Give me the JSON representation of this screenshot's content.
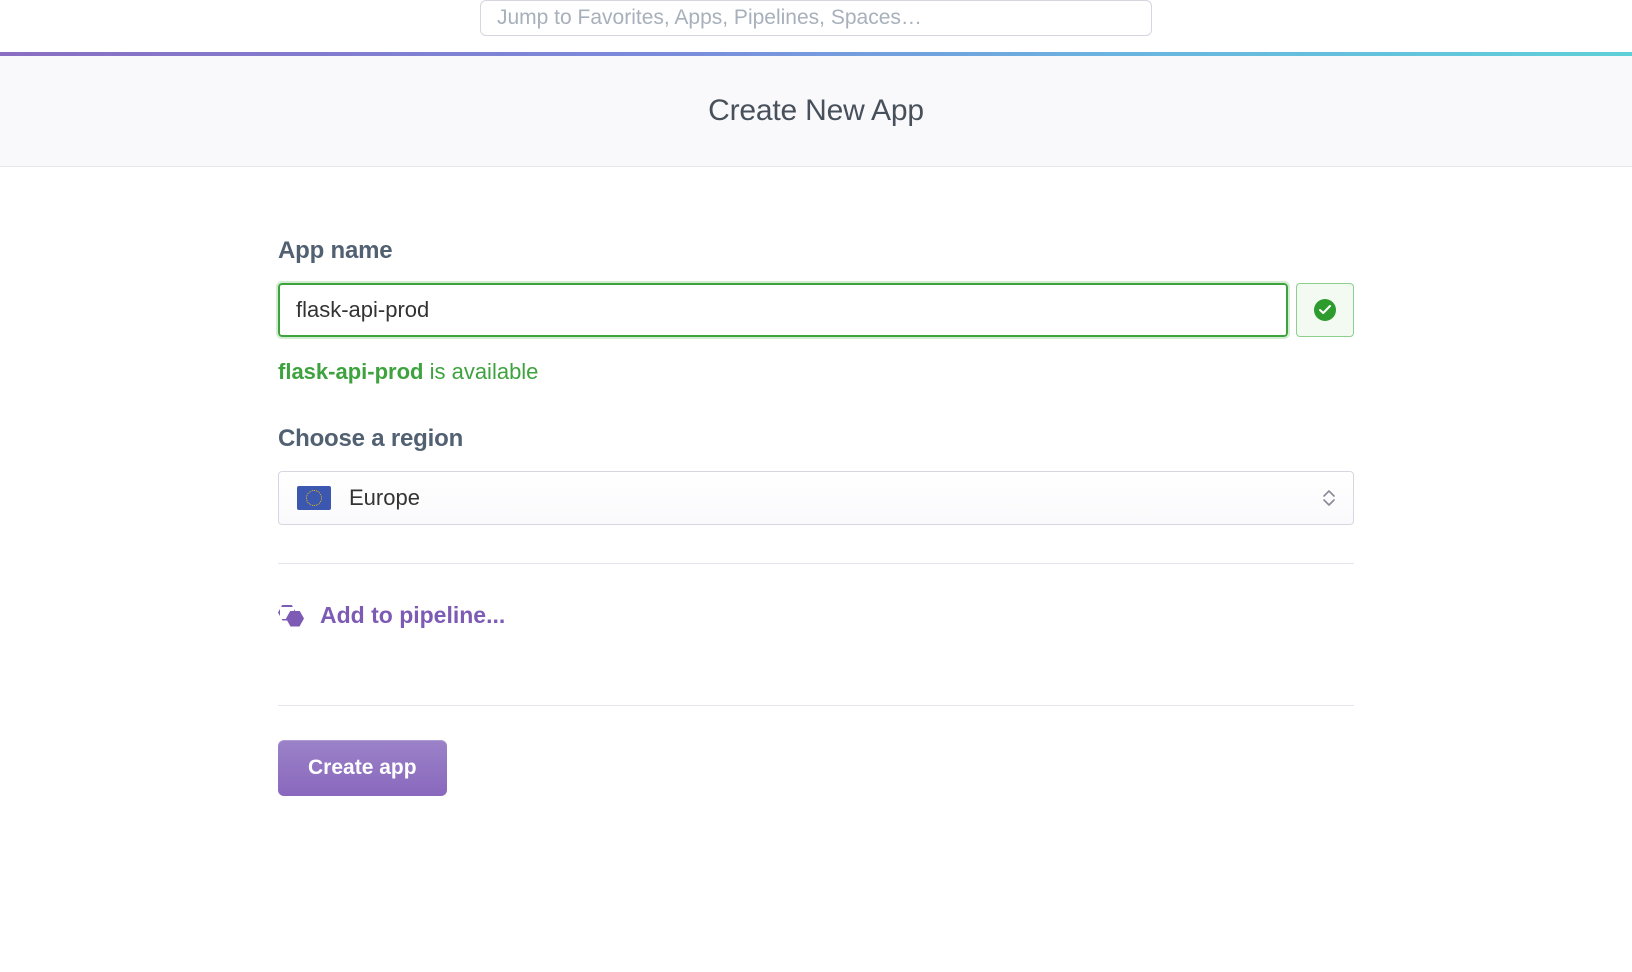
{
  "search": {
    "placeholder": "Jump to Favorites, Apps, Pipelines, Spaces…",
    "value": ""
  },
  "header": {
    "title": "Create New App"
  },
  "form": {
    "app_name": {
      "label": "App name",
      "value": "flask-api-prod",
      "availability_prefix": "flask-api-prod",
      "availability_suffix": " is available"
    },
    "region": {
      "label": "Choose a region",
      "selected": "Europe"
    },
    "pipeline": {
      "label": "Add to pipeline..."
    },
    "submit": {
      "label": "Create app"
    }
  }
}
